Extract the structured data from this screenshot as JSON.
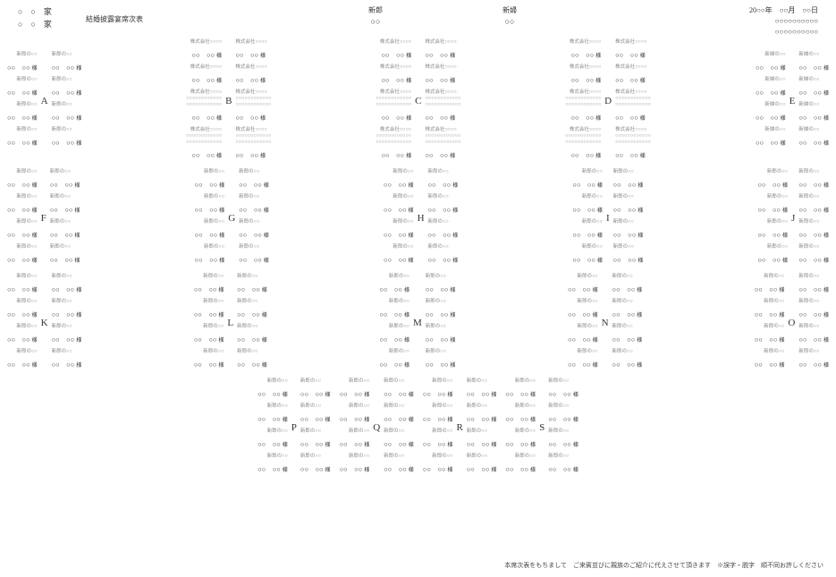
{
  "header": {
    "family1": "○　○　家",
    "family2": "○　○　家",
    "title": "結婚披露宴席次表",
    "groom_role": "新郎",
    "groom_name": "○○",
    "bride_role": "新婦",
    "bride_name": "○○",
    "date_line": "20○○年　○○月　○○日",
    "venue1": "○○○○○○○○○○",
    "venue2": "○○○○○○○○○○"
  },
  "footer": "本席次表をもちまして　ご来賓並びに親族のご紹介に代えさせて頂きます　※誤字・脱字　順不同お許しください",
  "honorific": "様",
  "guest": {
    "g_std": {
      "label": "新郎の○○",
      "name": "○○　○○"
    },
    "b_std": {
      "label": "新婦の○○",
      "name": "○○　○○"
    },
    "co1": {
      "label": "株式会社○○○○",
      "name": "○○　○○"
    },
    "co3": {
      "l1": "株式会社○○○○",
      "l2": "○○○○○○○○○○○○",
      "l3": "○○○○○○○○○○○○",
      "name": "○○　○○"
    }
  },
  "tables": [
    {
      "letter": "A",
      "left": [
        "g_std",
        "g_std",
        "g_std",
        "g_std"
      ],
      "right": [
        "g_std",
        "g_std",
        "g_std",
        "g_std"
      ]
    },
    {
      "letter": "B",
      "left": [
        "co1",
        "co1",
        "co3",
        "co3"
      ],
      "right": [
        "co1",
        "co1",
        "co3",
        "co3"
      ]
    },
    {
      "letter": "C",
      "left": [
        "co1",
        "co1",
        "co3",
        "co3"
      ],
      "right": [
        "co1",
        "co1",
        "co3",
        "co3"
      ]
    },
    {
      "letter": "D",
      "left": [
        "co1",
        "co1",
        "co3",
        "co3"
      ],
      "right": [
        "co1",
        "co1",
        "co3",
        "co3"
      ]
    },
    {
      "letter": "E",
      "left": [
        "b_std",
        "b_std",
        "b_std",
        "b_std"
      ],
      "right": [
        "b_std",
        "b_std",
        "b_std",
        "b_std"
      ]
    },
    {
      "letter": "F",
      "left": [
        "g_std",
        "g_std",
        "g_std",
        "g_std"
      ],
      "right": [
        "g_std",
        "g_std",
        "g_std",
        "g_std"
      ]
    },
    {
      "letter": "G",
      "left": [
        "g_std",
        "g_std",
        "g_std",
        "g_std"
      ],
      "right": [
        "g_std",
        "g_std",
        "g_std",
        "g_std"
      ]
    },
    {
      "letter": "H",
      "left": [
        "g_std",
        "g_std",
        "g_std",
        "g_std"
      ],
      "right": [
        "g_std",
        "g_std",
        "g_std",
        "g_std"
      ]
    },
    {
      "letter": "I",
      "left": [
        "g_std",
        "g_std",
        "g_std",
        "g_std"
      ],
      "right": [
        "g_std",
        "g_std",
        "g_std",
        "g_std"
      ]
    },
    {
      "letter": "J",
      "left": [
        "g_std",
        "g_std",
        "g_std",
        "g_std"
      ],
      "right": [
        "g_std",
        "g_std",
        "g_std",
        "g_std"
      ]
    },
    {
      "letter": "K",
      "left": [
        "g_std",
        "g_std",
        "g_std",
        "g_std"
      ],
      "right": [
        "g_std",
        "g_std",
        "g_std",
        "g_std"
      ]
    },
    {
      "letter": "L",
      "left": [
        "g_std",
        "g_std",
        "g_std",
        "g_std"
      ],
      "right": [
        "g_std",
        "g_std",
        "g_std",
        "g_std"
      ]
    },
    {
      "letter": "M",
      "left": [
        "g_std",
        "g_std",
        "g_std",
        "g_std"
      ],
      "right": [
        "g_std",
        "g_std",
        "g_std",
        "g_std"
      ]
    },
    {
      "letter": "N",
      "left": [
        "g_std",
        "g_std",
        "g_std",
        "g_std"
      ],
      "right": [
        "g_std",
        "g_std",
        "g_std",
        "g_std"
      ]
    },
    {
      "letter": "O",
      "left": [
        "g_std",
        "g_std",
        "g_std",
        "g_std"
      ],
      "right": [
        "g_std",
        "g_std",
        "g_std",
        "g_std"
      ]
    },
    {
      "letter": "P",
      "left": [
        "g_std",
        "g_std",
        "g_std",
        "g_std"
      ],
      "right": [
        "g_std",
        "g_std",
        "g_std",
        "g_std"
      ]
    },
    {
      "letter": "Q",
      "left": [
        "g_std",
        "g_std",
        "g_std",
        "g_std"
      ],
      "right": [
        "g_std",
        "g_std",
        "g_std",
        "g_std"
      ]
    },
    {
      "letter": "R",
      "left": [
        "g_std",
        "g_std",
        "g_std",
        "g_std"
      ],
      "right": [
        "g_std",
        "g_std",
        "g_std",
        "g_std"
      ]
    },
    {
      "letter": "S",
      "left": [
        "g_std",
        "g_std",
        "g_std",
        "g_std"
      ],
      "right": [
        "g_std",
        "g_std",
        "g_std",
        "g_std"
      ]
    }
  ],
  "rows": [
    [
      0,
      1,
      2,
      3,
      4
    ],
    [
      5,
      6,
      7,
      8,
      9
    ],
    [
      10,
      11,
      12,
      13,
      14
    ],
    [
      15,
      16,
      17,
      18
    ]
  ]
}
